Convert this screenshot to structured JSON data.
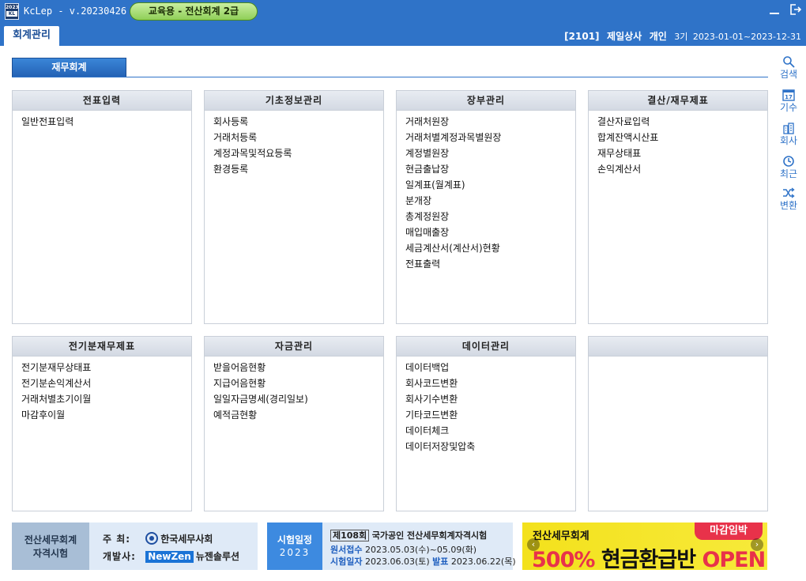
{
  "titlebar": {
    "app_title": "KcLep - v.20230426",
    "logo_top": "2023",
    "logo_bottom": "KL",
    "edition": "교육용 - 전산회계 2급"
  },
  "tabs": {
    "main": "회계관리"
  },
  "company": {
    "code": "[2101]",
    "name": "제일상사",
    "type": "개인",
    "period": "3기",
    "range": "2023-01-01~2023-12-31"
  },
  "section": {
    "title": "재무회계"
  },
  "panels": [
    {
      "title": "전표입력",
      "items": [
        "일반전표입력"
      ]
    },
    {
      "title": "기초정보관리",
      "items": [
        "회사등록",
        "거래처등록",
        "계정과목및적요등록",
        "환경등록"
      ]
    },
    {
      "title": "장부관리",
      "items": [
        "거래처원장",
        "거래처별계정과목별원장",
        "계정별원장",
        "현금출납장",
        "일계표(월계표)",
        "분개장",
        "총계정원장",
        "매입매출장",
        "세금계산서(계산서)현황",
        "전표출력"
      ]
    },
    {
      "title": "결산/재무제표",
      "items": [
        "결산자료입력",
        "합계잔액시산표",
        "재무상태표",
        "손익계산서"
      ]
    },
    {
      "title": "전기분재무제표",
      "items": [
        "전기분재무상태표",
        "전기분손익계산서",
        "거래처별초기이월",
        "마감후이월"
      ]
    },
    {
      "title": "자금관리",
      "items": [
        "받을어음현황",
        "지급어음현황",
        "일일자금명세(경리일보)",
        "예적금현황"
      ]
    },
    {
      "title": "데이터관리",
      "items": [
        "데이터백업",
        "회사코드변환",
        "회사기수변환",
        "기타코드변환",
        "데이터체크",
        "데이터저장및압축"
      ]
    },
    {
      "title": "",
      "items": []
    }
  ],
  "sidebar": {
    "search": "검색",
    "period": "기수",
    "period_icon_num": "17",
    "company": "회사",
    "recent": "최근",
    "convert": "변환"
  },
  "banners": {
    "exam": {
      "title_line1": "전산세무회계",
      "title_line2": "자격시험",
      "host_label": "주 최:",
      "host": "한국세무사회",
      "dev_label": "개발사:",
      "dev_brand": "NewZen",
      "dev_name": "뉴젠솔루션"
    },
    "schedule": {
      "label": "시험일정",
      "year": "2023",
      "round": "제108회",
      "name": "국가공인 전산세무회계자격시험",
      "apply_label": "원서접수",
      "apply": "2023.05.03(수)~05.09(화)",
      "exam_label": "시험일자",
      "exam": "2023.06.03(토)",
      "result_label": "발표",
      "result": "2023.06.22(목)"
    },
    "promo": {
      "top": "전산세무회계",
      "deadline": "마감임박",
      "pct": "500%",
      "mid": "현금환급반",
      "open": "OPEN!"
    }
  }
}
